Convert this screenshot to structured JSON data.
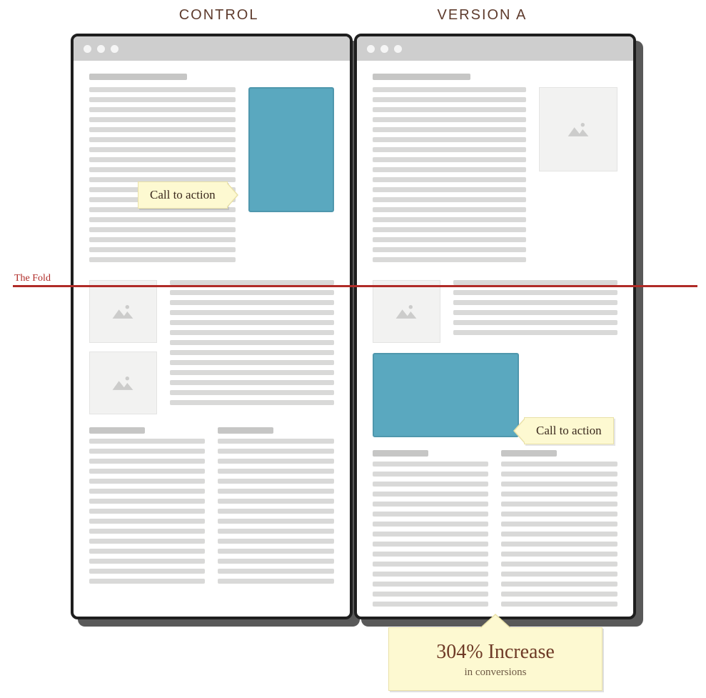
{
  "labels": {
    "control": "CONTROL",
    "variant": "VERSION A"
  },
  "fold_label": "The Fold",
  "cta_label_control": "Call to action",
  "cta_label_variant": "Call to action",
  "result": {
    "headline": "304% Increase",
    "sub": "in conversions"
  },
  "colors": {
    "cta": "#5aa8bf",
    "note": "#fdf9d1",
    "fold": "#b02b27",
    "placeholder": "#d9d9d8"
  }
}
